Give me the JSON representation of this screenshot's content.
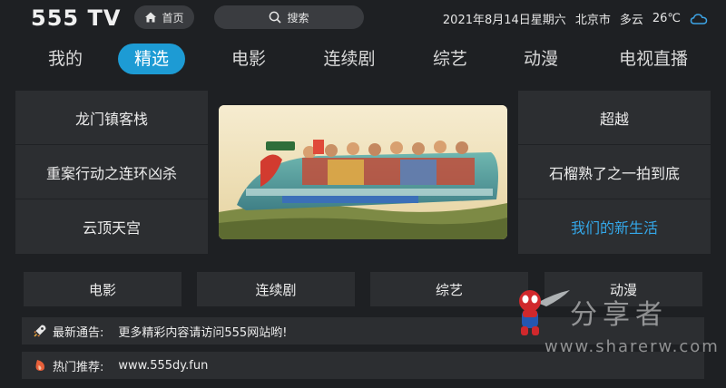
{
  "header": {
    "logo": "555 TV",
    "home_label": "首页",
    "search_placeholder": "搜索",
    "date": "2021年8月14日星期六",
    "city": "北京市",
    "weather": "多云",
    "temperature": "26℃"
  },
  "tabs": [
    "我的",
    "精选",
    "电影",
    "连续剧",
    "综艺",
    "动漫",
    "电视直播"
  ],
  "active_tab": "精选",
  "left_list": [
    "龙门镇客栈",
    "重案行动之连环凶杀",
    "云顶天宫"
  ],
  "right_list": [
    "超越",
    "石榴熟了之一拍到底",
    "我们的新生活"
  ],
  "categories": [
    "电影",
    "连续剧",
    "综艺",
    "动漫"
  ],
  "notice": {
    "label": "最新通告:",
    "text": "更多精彩内容请访问555网站哟!"
  },
  "recommend": {
    "label": "热门推荐:",
    "text": "www.555dy.fun"
  },
  "watermark": {
    "text": "分享者",
    "url": "www.sharerw.com"
  },
  "colors": {
    "background": "#1e2023",
    "panel": "#2c2e31",
    "accent": "#1d9bd4",
    "highlight_text": "#34a7e8"
  }
}
